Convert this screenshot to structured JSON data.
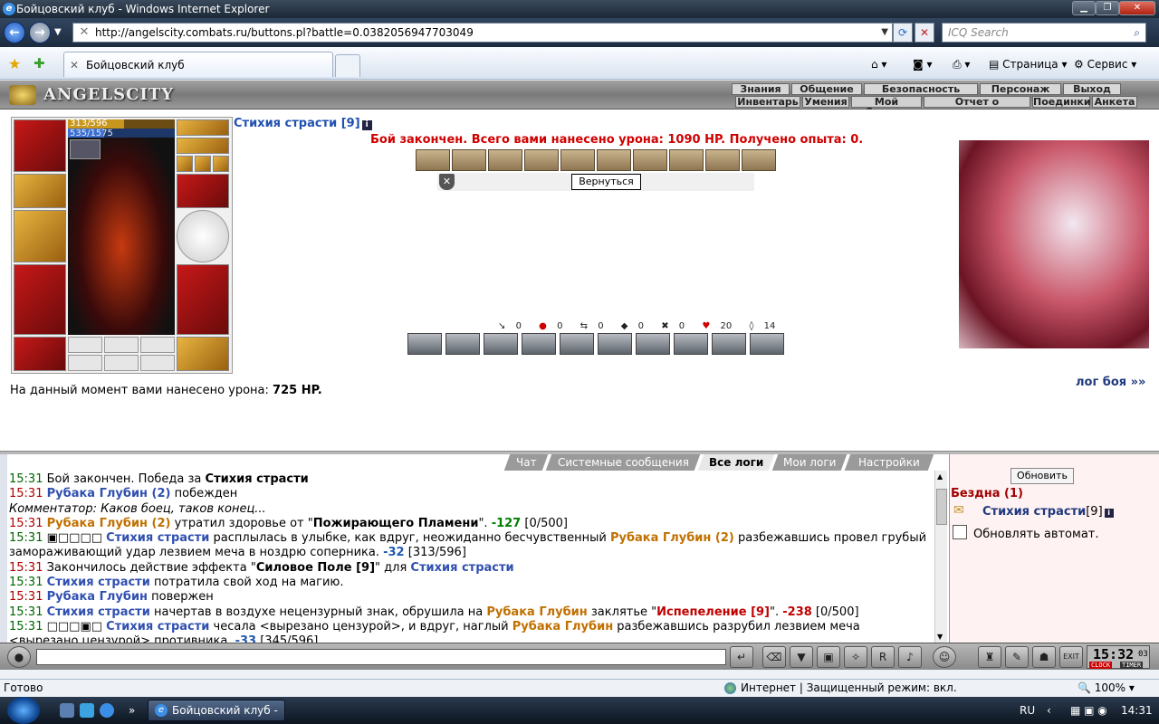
{
  "window": {
    "title": "Бойцовский клуб - Windows Internet Explorer"
  },
  "browser": {
    "url": "http://angelscity.combats.ru/buttons.pl?battle=0.0382056947703049",
    "search_placeholder": "ICQ Search",
    "tab_title": "Бойцовский клуб",
    "toolbar": {
      "page": "Страница",
      "tools": "Сервис"
    },
    "status": {
      "ready": "Готово",
      "zone": "Интернет | Защищенный режим: вкл.",
      "zoom": "100%"
    }
  },
  "game": {
    "logo": "ANGELSCITY",
    "menu_top": [
      "Знания",
      "Общение",
      "Безопасность",
      "Персонаж",
      "Выход"
    ],
    "menu_bottom": [
      "Инвентарь",
      "Умения",
      "Мой Скролл",
      "Отчет о переводах",
      "Поединки",
      "Анкета"
    ],
    "character": {
      "name": "Стихия страсти [9]",
      "hp_text": "313/596",
      "hp_fraction": 0.525,
      "mp_text": "535/1575",
      "mp_fraction": 0.34
    },
    "battle_message": "Бой закончен. Всего вами нанесено урона: 1090 HP. Получено опыта: 0.",
    "return_button": "Вернуться",
    "stats": [
      {
        "icon": "sword-icon",
        "glyph": "↘",
        "value": "0"
      },
      {
        "icon": "blood-drop-icon",
        "glyph": "●",
        "value": "0"
      },
      {
        "icon": "counter-icon",
        "glyph": "⇆",
        "value": "0"
      },
      {
        "icon": "block-icon",
        "glyph": "◆",
        "value": "0"
      },
      {
        "icon": "crossed-swords-icon",
        "glyph": "✖",
        "value": "0"
      },
      {
        "icon": "heart-icon",
        "glyph": "♥",
        "value": "20"
      },
      {
        "icon": "shield-icon",
        "glyph": "◊",
        "value": "14"
      }
    ],
    "damage_text_prefix": "На данный момент вами нанесено урона:",
    "damage_value": "725 HP.",
    "log_link": "лог боя »»"
  },
  "chat": {
    "tabs": [
      "Чат",
      "Системные сообщения",
      "Все логи",
      "Мои логи",
      "Настройки"
    ],
    "active_tab": "Все логи",
    "lines": [
      [
        {
          "c": "t",
          "x": "15:31"
        },
        {
          "x": " Бой закончен. Победа за "
        },
        {
          "c": "bold",
          "x": "Стихия страсти"
        }
      ],
      [
        {
          "c": "t red",
          "x": "15:31"
        },
        {
          "x": " "
        },
        {
          "c": "p",
          "x": "Рубака Глубин (2)"
        },
        {
          "x": " побежден"
        }
      ],
      [
        {
          "c": "i",
          "x": "Комментатор: Каков боец, таков конец..."
        }
      ],
      [
        {
          "c": "t red",
          "x": "15:31"
        },
        {
          "x": " "
        },
        {
          "c": "e",
          "x": "Рубака Глубин (2)"
        },
        {
          "x": " утратил здоровье от \""
        },
        {
          "c": "bold",
          "x": "Пожирающего Пламени"
        },
        {
          "x": "\". "
        },
        {
          "c": "dmg",
          "x": "-127"
        },
        {
          "x": " [0/500]"
        }
      ],
      [
        {
          "c": "t",
          "x": "15:31"
        },
        {
          "x": " ▣□□□□ "
        },
        {
          "c": "p",
          "x": "Стихия страсти"
        },
        {
          "x": " расплылась в улыбке, как вдруг, неожиданно бесчувственный "
        },
        {
          "c": "e",
          "x": "Рубака Глубин (2)"
        },
        {
          "x": " разбежавшись провел грубый замораживающий удар лезвием меча в ноздрю соперника. "
        },
        {
          "c": "dmgb",
          "x": "-32"
        },
        {
          "x": " [313/596]"
        }
      ],
      [
        {
          "c": "t red",
          "x": "15:31"
        },
        {
          "x": " Закончилось действие эффекта \""
        },
        {
          "c": "bold",
          "x": "Силовое Поле [9]"
        },
        {
          "x": "\" для "
        },
        {
          "c": "p",
          "x": "Стихия страсти"
        }
      ],
      [
        {
          "c": "t",
          "x": "15:31"
        },
        {
          "x": " "
        },
        {
          "c": "p",
          "x": "Стихия страсти"
        },
        {
          "x": " потратила свой ход на магию."
        }
      ],
      [
        {
          "c": "t red",
          "x": "15:31"
        },
        {
          "x": " "
        },
        {
          "c": "p",
          "x": "Рубака Глубин"
        },
        {
          "x": " повержен"
        }
      ],
      [
        {
          "c": "t",
          "x": "15:31"
        },
        {
          "x": " "
        },
        {
          "c": "p",
          "x": "Стихия страсти"
        },
        {
          "x": " начертав в воздухе нецензурный знак, обрушила на "
        },
        {
          "c": "e",
          "x": "Рубака Глубин"
        },
        {
          "x": " заклятье \""
        },
        {
          "c": "sp",
          "x": "Испепеление [9]"
        },
        {
          "x": "\". "
        },
        {
          "c": "dmgr",
          "x": "-238"
        },
        {
          "x": " [0/500]"
        }
      ],
      [
        {
          "c": "t",
          "x": "15:31"
        },
        {
          "x": " □□□▣□ "
        },
        {
          "c": "p",
          "x": "Стихия страсти"
        },
        {
          "x": " чесала <вырезано цензурой>, и вдруг, наглый "
        },
        {
          "c": "e",
          "x": "Рубака Глубин"
        },
        {
          "x": " разбежавшись разрубил лезвием меча <вырезано цензурой> противника. "
        },
        {
          "c": "dmgb",
          "x": "-33"
        },
        {
          "x": " [345/596]"
        }
      ]
    ]
  },
  "side": {
    "refresh": "Обновить",
    "location": "Бездна (1)",
    "user_name": "Стихия страсти",
    "user_level": "[9]",
    "auto_refresh_label": "Обновлять автомат."
  },
  "clock": {
    "time": "15:32",
    "sec": "03",
    "label1": "CLOCK",
    "label2": "TIMER"
  },
  "taskbar": {
    "item": "Бойцовский клуб - ...",
    "lang": "RU",
    "time": "14:31"
  }
}
